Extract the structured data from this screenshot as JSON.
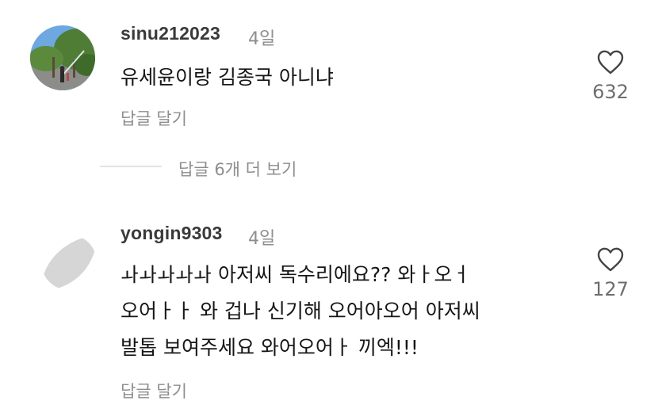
{
  "comments": [
    {
      "username": "sinu212023",
      "time": "4일",
      "lines": [
        "유세윤이랑 김종국 아니냐"
      ],
      "reply_label": "답글 달기",
      "likes": "632",
      "more_replies": "답글 6개 더 보기"
    },
    {
      "username": "yongin9303",
      "time": "4일",
      "lines": [
        "ㅘㅘㅘㅘㅘ 아저씨 독수리에요?? 와ㅏ오ㅓ",
        "오어ㅏㅏ 와 겁나 신기해 오어아오어 아저씨",
        "발톱 보여주세요 와어오어ㅏ 끼엑!!!"
      ],
      "reply_label": "답글 달기",
      "likes": "127"
    }
  ]
}
